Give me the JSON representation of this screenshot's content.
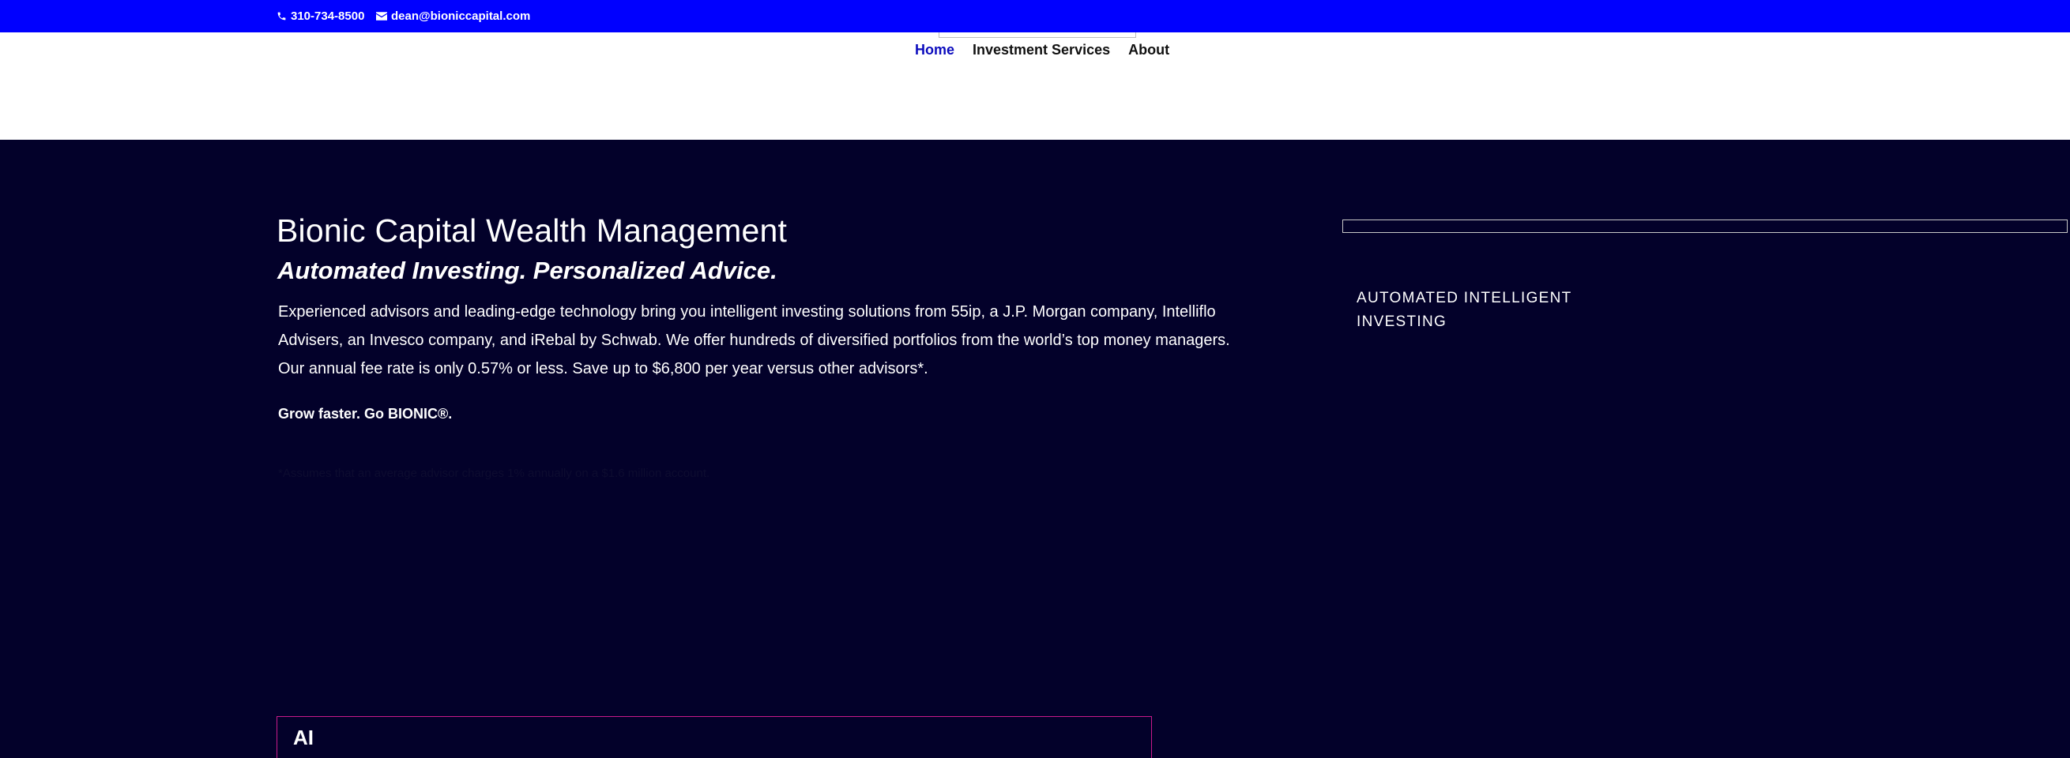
{
  "topbar": {
    "phone": "310-734-8500",
    "email": "dean@bioniccapital.com",
    "bg_color": "#0000ff"
  },
  "nav": {
    "items": [
      {
        "label": "Home",
        "active": true
      },
      {
        "label": "Investment Services",
        "active": false
      },
      {
        "label": "About",
        "active": false
      }
    ],
    "active_color": "#0b0bbd"
  },
  "hero": {
    "title": "Bionic Capital Wealth Management",
    "subtitle": "Automated Investing. Personalized Advice.",
    "body": "Experienced advisors and leading-edge technology bring you intelligent investing solutions from 55ip, a J.P. Morgan company, Intelliflo Advisers, an Invesco company, and iRebal by Schwab. We offer hundreds of diversified portfolios from the world’s top money managers. Our annual fee rate is only 0.57% or less. Save up to $6,800 per year versus other advisors*.",
    "tagline": "Grow faster. Go BIONIC®.",
    "footnote": "*Assumes that an average advisor charges 1% annually on a $1.6 million account.",
    "bg_color": "#03012a"
  },
  "sidebar": {
    "label": "AUTOMATED INTELLIGENT INVESTING"
  },
  "section": {
    "title": "AI",
    "border_color": "#c81a8a"
  },
  "icons": {
    "phone": "phone-icon",
    "email": "mail-icon"
  }
}
